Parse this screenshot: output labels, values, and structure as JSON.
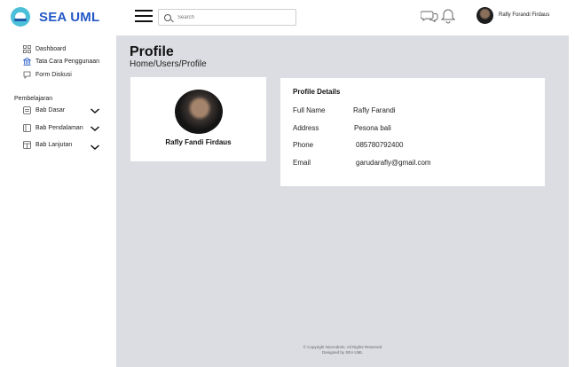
{
  "app": {
    "name": "SEA UML"
  },
  "header": {
    "search_placeholder": "Search",
    "user_name": "Rafly Forandi Firdaus"
  },
  "sidebar": {
    "items": [
      {
        "label": "Dashboard",
        "icon": "grid-icon"
      },
      {
        "label": "Tata Cara Penggunaan",
        "icon": "building-icon"
      },
      {
        "label": "Form Diskusi",
        "icon": "comment-icon"
      }
    ],
    "section_label": "Pembelajaran",
    "learning_items": [
      {
        "label": "Bab Dasar",
        "icon": "layers-icon"
      },
      {
        "label": "Bab Pendalaman",
        "icon": "book-icon"
      },
      {
        "label": "Bab Lanjutan",
        "icon": "window-icon"
      }
    ]
  },
  "main": {
    "title": "Profile",
    "breadcrumb": "Home/Users/Profile",
    "profile_card": {
      "name": "Rafly Fandi Firdaus"
    },
    "details": {
      "title": "Profile Details",
      "rows": [
        {
          "label": "Full Name",
          "value": "Rafly Farandi"
        },
        {
          "label": "Address",
          "value": "Pesona bali"
        },
        {
          "label": "Phone",
          "value": "085780792400"
        },
        {
          "label": "Email",
          "value": "garudarafly@gmail.com"
        }
      ]
    },
    "footer": {
      "copyright": "© Copyright NiceAdmin. All Rights Reserved",
      "designed_by": "Designed by SEA UML"
    }
  },
  "colors": {
    "brand": "#2458c6",
    "logo_accent": "#4cc0d9",
    "main_background": "#dcdde2",
    "card_background": "#ffffff"
  }
}
